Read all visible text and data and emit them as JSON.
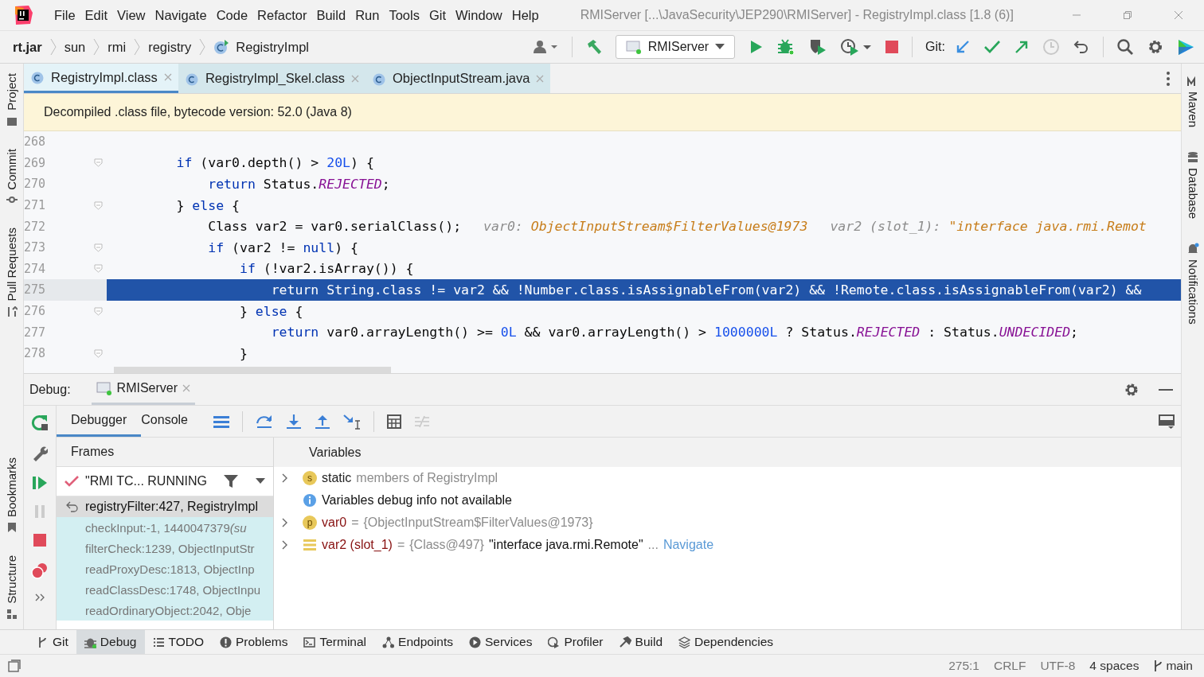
{
  "window": {
    "title": "RMIServer [...\\JavaSecurity\\JEP290\\RMIServer] - RegistryImpl.class [1.8 (6)]"
  },
  "menu": [
    "File",
    "Edit",
    "View",
    "Navigate",
    "Code",
    "Refactor",
    "Build",
    "Run",
    "Tools",
    "Git",
    "Window",
    "Help"
  ],
  "breadcrumbs": [
    {
      "label": "rt.jar",
      "kind": "root"
    },
    {
      "label": "sun",
      "kind": "package"
    },
    {
      "label": "rmi",
      "kind": "package"
    },
    {
      "label": "registry",
      "kind": "package"
    },
    {
      "label": "RegistryImpl",
      "kind": "class"
    }
  ],
  "toolbar": {
    "run_config": "RMIServer",
    "git_label": "Git:"
  },
  "left_stripe": {
    "top": [
      "Project",
      "Commit",
      "Pull Requests"
    ],
    "bottom": [
      "Bookmarks",
      "Structure"
    ]
  },
  "right_stripe": [
    "Maven",
    "Database",
    "Notifications"
  ],
  "editor_tabs": [
    {
      "label": "RegistryImpl.class",
      "selected": true
    },
    {
      "label": "RegistryImpl_Skel.class",
      "selected": false
    },
    {
      "label": "ObjectInputStream.java",
      "selected": false
    }
  ],
  "banner": "Decompiled .class file, bytecode version: 52.0 (Java 8)",
  "code_lines": [
    {
      "number": "268",
      "fold": false,
      "current": false
    },
    {
      "number": "269",
      "fold": true,
      "current": false,
      "tokens": [
        {
          "kind": "kw",
          "text": "        if"
        },
        {
          "kind": "text",
          "text": " (var0.depth() > "
        },
        {
          "kind": "num",
          "text": "20L"
        },
        {
          "kind": "text",
          "text": ") {"
        }
      ]
    },
    {
      "number": "270",
      "fold": false,
      "current": false,
      "tokens": [
        {
          "kind": "kw",
          "text": "            return"
        },
        {
          "kind": "text",
          "text": " Status."
        },
        {
          "kind": "const",
          "text": "REJECTED"
        },
        {
          "kind": "text",
          "text": ";"
        }
      ]
    },
    {
      "number": "271",
      "fold": true,
      "current": false,
      "tokens": [
        {
          "kind": "text",
          "text": "        } "
        },
        {
          "kind": "kw",
          "text": "else"
        },
        {
          "kind": "text",
          "text": " {"
        }
      ]
    },
    {
      "number": "272",
      "fold": false,
      "current": false,
      "tokens": [
        {
          "kind": "text",
          "text": "            Class var2 = var0.serialClass();"
        }
      ],
      "hints": [
        {
          "name": "var0:",
          "value": "ObjectInputStream$FilterValues@1973"
        },
        {
          "name": "var2 (slot_1):",
          "value": "\"interface java.rmi.Remot"
        }
      ]
    },
    {
      "number": "273",
      "fold": true,
      "current": false,
      "tokens": [
        {
          "kind": "kw",
          "text": "            if"
        },
        {
          "kind": "text",
          "text": " (var2 != "
        },
        {
          "kind": "kw",
          "text": "null"
        },
        {
          "kind": "text",
          "text": ") {"
        }
      ]
    },
    {
      "number": "274",
      "fold": true,
      "current": false,
      "tokens": [
        {
          "kind": "kw",
          "text": "                if"
        },
        {
          "kind": "text",
          "text": " (!var2.isArray()) {"
        }
      ]
    },
    {
      "number": "275",
      "fold": false,
      "current": true,
      "tokens": [
        {
          "kind": "kw",
          "text": "                    return"
        },
        {
          "kind": "text",
          "text": " String.class != var2 && !Number.class.isAssignableFrom(var2) && !Remote.class.isAssignableFrom(var2) &&"
        }
      ]
    },
    {
      "number": "276",
      "fold": true,
      "current": false,
      "tokens": [
        {
          "kind": "text",
          "text": "                } "
        },
        {
          "kind": "kw",
          "text": "else"
        },
        {
          "kind": "text",
          "text": " {"
        }
      ]
    },
    {
      "number": "277",
      "fold": false,
      "current": false,
      "tokens": [
        {
          "kind": "kw",
          "text": "                    return"
        },
        {
          "kind": "text",
          "text": " var0.arrayLength() >= "
        },
        {
          "kind": "num",
          "text": "0L"
        },
        {
          "kind": "text",
          "text": " && var0.arrayLength() > "
        },
        {
          "kind": "num",
          "text": "1000000L"
        },
        {
          "kind": "text",
          "text": " ? Status."
        },
        {
          "kind": "const",
          "text": "REJECTED"
        },
        {
          "kind": "text",
          "text": " : Status."
        },
        {
          "kind": "const",
          "text": "UNDECIDED"
        },
        {
          "kind": "text",
          "text": ";"
        }
      ]
    },
    {
      "number": "278",
      "fold": true,
      "current": false,
      "tokens": [
        {
          "kind": "text",
          "text": "                }"
        }
      ]
    }
  ],
  "debug": {
    "label": "Debug:",
    "session": "RMIServer",
    "tabs": [
      {
        "label": "Debugger",
        "selected": true
      },
      {
        "label": "Console",
        "selected": false
      }
    ],
    "frames_title": "Frames",
    "thread": "\"RMI TC... RUNNING",
    "frames": [
      {
        "label": "registryFilter:427, RegistryImpl",
        "selected": true,
        "library": false
      },
      {
        "label": "checkInput:-1, 1440047379",
        "suffix": "(su",
        "selected": false,
        "library": true
      },
      {
        "label": "filterCheck:1239, ObjectInputStr",
        "selected": false,
        "library": true
      },
      {
        "label": "readProxyDesc:1813, ObjectInp",
        "selected": false,
        "library": true
      },
      {
        "label": "readClassDesc:1748, ObjectInpu",
        "selected": false,
        "library": true
      },
      {
        "label": "readOrdinaryObject:2042, Obje",
        "selected": false,
        "library": true
      }
    ],
    "variables_title": "Variables",
    "variables": [
      {
        "kind": "static",
        "expandable": true,
        "badge": "s",
        "name": "static",
        "value": "members of RegistryImpl"
      },
      {
        "kind": "info",
        "expandable": false,
        "value": "Variables debug info not available"
      },
      {
        "kind": "param",
        "expandable": true,
        "badge": "p",
        "name": "var0",
        "eq": "=",
        "ref": "{ObjectInputStream$FilterValues@1973}"
      },
      {
        "kind": "field",
        "expandable": true,
        "name": "var2 (slot_1)",
        "eq": "=",
        "ref": "{Class@497}",
        "value": "\"interface java.rmi.Remote\"",
        "ellipsis": "...",
        "link": "Navigate"
      }
    ]
  },
  "tool_windows": [
    {
      "label": "Git",
      "selected": false
    },
    {
      "label": "Debug",
      "selected": true
    },
    {
      "label": "TODO",
      "selected": false
    },
    {
      "label": "Problems",
      "selected": false
    },
    {
      "label": "Terminal",
      "selected": false
    },
    {
      "label": "Endpoints",
      "selected": false
    },
    {
      "label": "Services",
      "selected": false
    },
    {
      "label": "Profiler",
      "selected": false
    },
    {
      "label": "Build",
      "selected": false
    },
    {
      "label": "Dependencies",
      "selected": false
    }
  ],
  "status_bar": {
    "position": "275:1",
    "line_sep": "CRLF",
    "encoding": "UTF-8",
    "indent": "4 spaces",
    "branch": "main"
  }
}
